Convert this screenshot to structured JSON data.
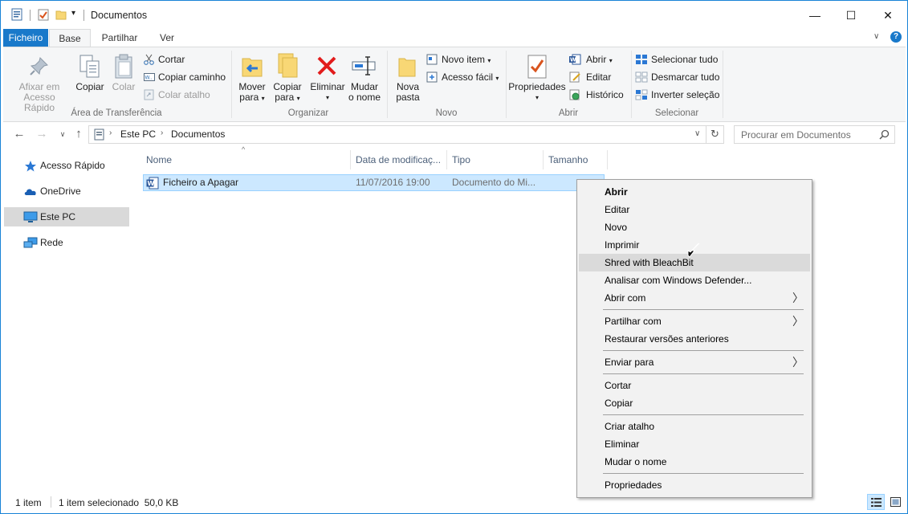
{
  "window": {
    "title": "Documentos",
    "controls": {
      "minimize": "—",
      "maximize": "☐",
      "close": "✕"
    }
  },
  "ribbon": {
    "tabs": [
      "Ficheiro",
      "Base",
      "Partilhar",
      "Ver"
    ],
    "help_icon": "?",
    "groups": {
      "clipboard": {
        "label": "Área de Transferência",
        "pin_quick_access": "Afixar em Acesso Rápido",
        "pin_line1": "Afixar em",
        "pin_line2": "Acesso Rápido",
        "copy": "Copiar",
        "paste": "Colar",
        "cut": "Cortar",
        "copy_path": "Copiar caminho",
        "paste_shortcut": "Colar atalho"
      },
      "organize": {
        "label": "Organizar",
        "move_line1": "Mover",
        "move_line2": "para",
        "copy_line1": "Copiar",
        "copy_line2": "para",
        "delete": "Eliminar",
        "rename_line1": "Mudar",
        "rename_line2": "o nome"
      },
      "new": {
        "label": "Novo",
        "new_folder_line1": "Nova",
        "new_folder_line2": "pasta",
        "new_item": "Novo item",
        "easy_access": "Acesso fácil"
      },
      "open": {
        "label": "Abrir",
        "properties": "Propriedades",
        "open": "Abrir",
        "edit": "Editar",
        "history": "Histórico"
      },
      "select": {
        "label": "Selecionar",
        "select_all": "Selecionar tudo",
        "select_none": "Desmarcar tudo",
        "invert": "Inverter seleção"
      }
    }
  },
  "address": {
    "path": [
      "Este PC",
      "Documentos"
    ],
    "search_placeholder": "Procurar em Documentos"
  },
  "nav_pane": {
    "items": [
      {
        "label": "Acesso Rápido",
        "icon": "star-icon"
      },
      {
        "label": "OneDrive",
        "icon": "cloud-icon"
      },
      {
        "label": "Este PC",
        "icon": "computer-icon"
      },
      {
        "label": "Rede",
        "icon": "network-icon"
      }
    ]
  },
  "file_list": {
    "columns": [
      "Nome",
      "Data de modificaç...",
      "Tipo",
      "Tamanho"
    ],
    "rows": [
      {
        "name": "Ficheiro a Apagar",
        "date": "11/07/2016 19:00",
        "type": "Documento do Mi...",
        "size": ""
      }
    ]
  },
  "context_menu": {
    "items": [
      "Abrir",
      "Editar",
      "Novo",
      "Imprimir",
      "Shred with BleachBit",
      "Analisar com Windows Defender...",
      "Abrir com",
      "Partilhar com",
      "Restaurar versões anteriores",
      "Enviar para",
      "Cortar",
      "Copiar",
      "Criar atalho",
      "Eliminar",
      "Mudar o nome",
      "Propriedades"
    ]
  },
  "status_bar": {
    "item_count": "1 item",
    "selection": "1 item selecionado  50,0 KB"
  },
  "colors": {
    "accent": "#1979ca",
    "selection": "#cce8ff",
    "menu_hover": "#dadada"
  }
}
